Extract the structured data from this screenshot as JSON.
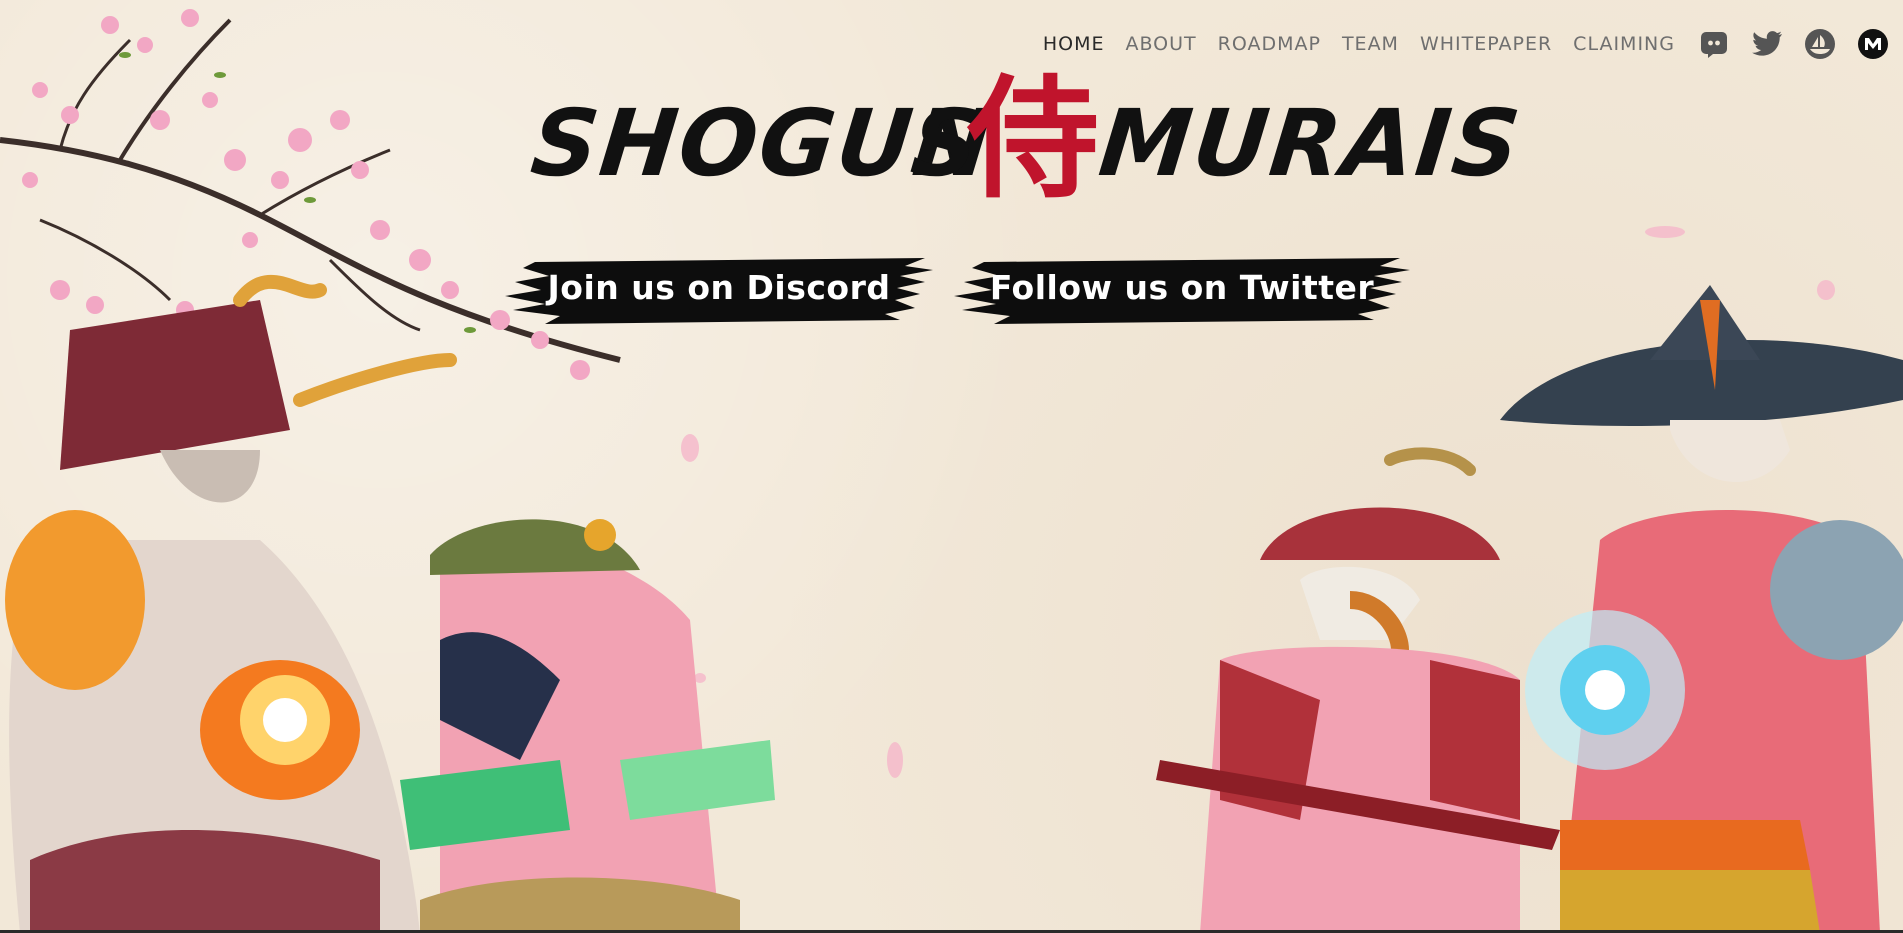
{
  "nav": {
    "links": [
      {
        "label": "HOME",
        "active": true
      },
      {
        "label": "ABOUT"
      },
      {
        "label": "ROADMAP"
      },
      {
        "label": "TEAM"
      },
      {
        "label": "WHITEPAPER"
      },
      {
        "label": "CLAIMING"
      }
    ],
    "social": [
      "discord-icon",
      "twitter-icon",
      "opensea-icon",
      "magiceden-icon"
    ]
  },
  "hero": {
    "title_left": "SHOGUN",
    "title_s": "S",
    "title_kanji": "侍",
    "title_right": "MURAIS",
    "discord_button": "Join us on Discord",
    "twitter_button": "Follow us on Twitter"
  },
  "colors": {
    "background": "#f2e8d8",
    "accent_red": "#c0142c",
    "ink": "#111111",
    "nav_text": "#6f6f6f"
  }
}
